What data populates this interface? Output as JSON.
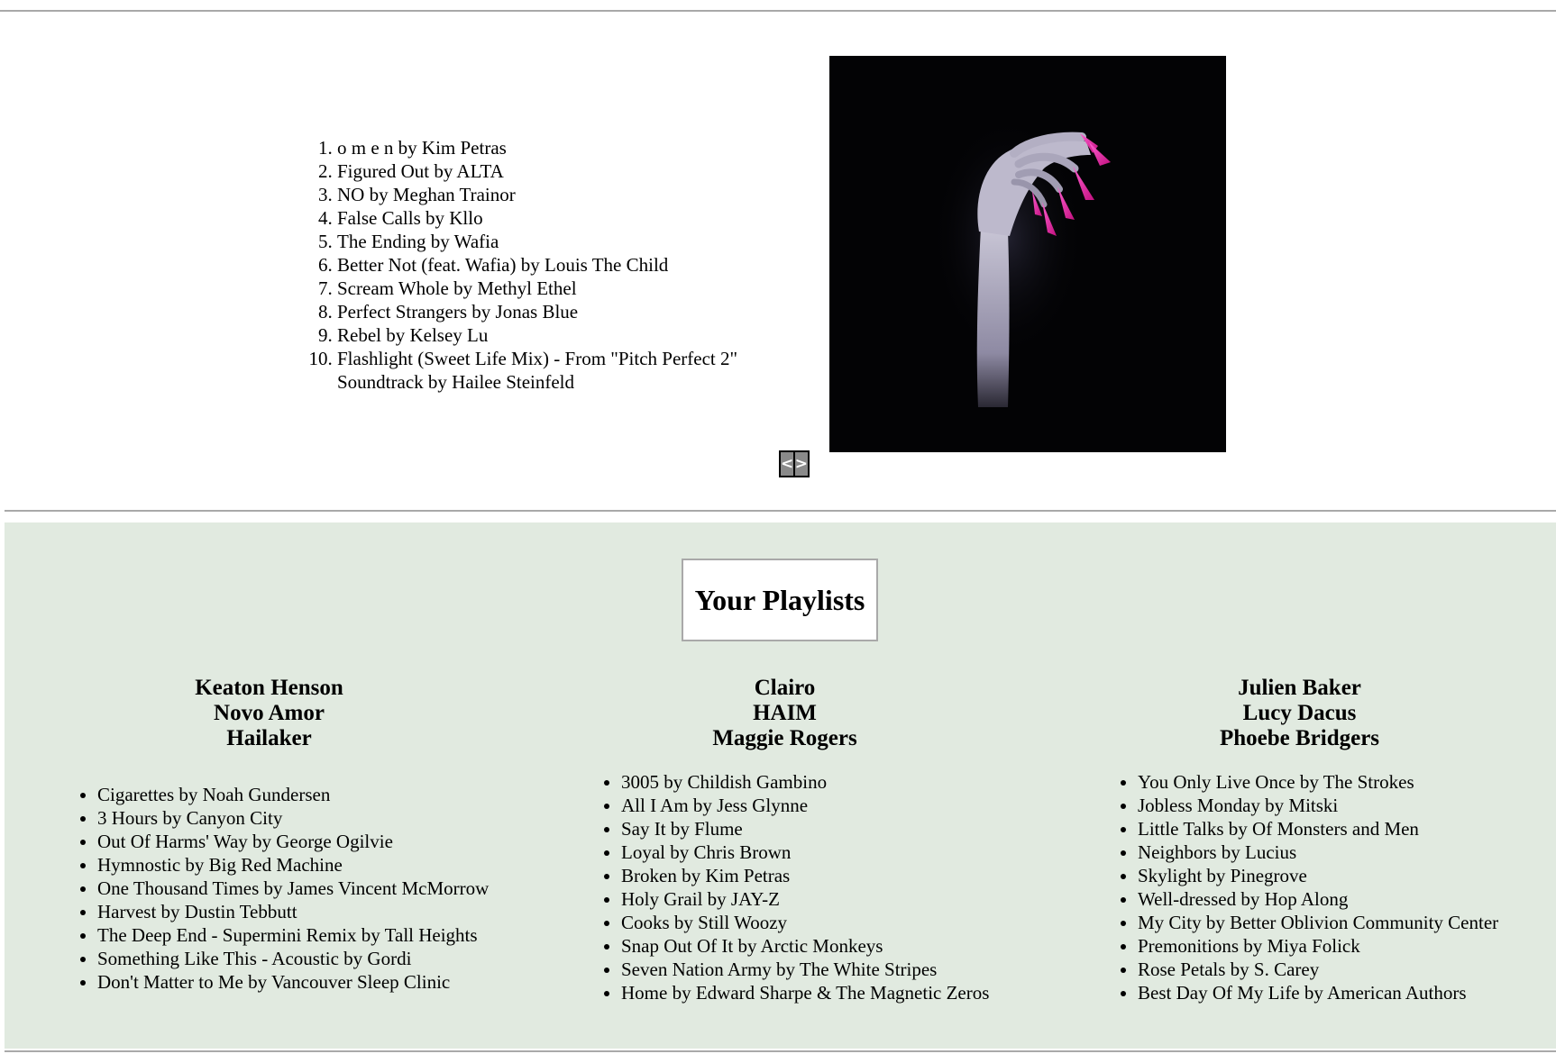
{
  "now_playing": {
    "tracks": [
      "o m e n by Kim Petras",
      "Figured Out by ALTA",
      "NO by Meghan Trainor",
      "False Calls by Kllo",
      "The Ending by Wafia",
      "Better Not (feat. Wafia) by Louis The Child",
      "Scream Whole by Methyl Ethel",
      "Perfect Strangers by Jonas Blue",
      "Rebel by Kelsey Lu",
      "Flashlight (Sweet Life Mix) - From \"Pitch Perfect 2\" Soundtrack by Hailee Steinfeld"
    ],
    "prev_label": "<",
    "next_label": ">"
  },
  "playlists": {
    "title": "Your Playlists",
    "items": [
      {
        "artists": [
          "Keaton Henson",
          "Novo Amor",
          "Hailaker"
        ],
        "songs": [
          "Cigarettes by Noah Gundersen",
          "3 Hours by Canyon City",
          "Out Of Harms' Way by George Ogilvie",
          "Hymnostic by Big Red Machine",
          "One Thousand Times by James Vincent McMorrow",
          "Harvest by Dustin Tebbutt",
          "The Deep End - Supermini Remix by Tall Heights",
          "Something Like This - Acoustic by Gordi",
          "Don't Matter to Me by Vancouver Sleep Clinic"
        ]
      },
      {
        "artists": [
          "Clairo",
          "HAIM",
          "Maggie Rogers"
        ],
        "songs": [
          "3005 by Childish Gambino",
          "All I Am by Jess Glynne",
          "Say It by Flume",
          "Loyal by Chris Brown",
          "Broken by Kim Petras",
          "Holy Grail by JAY-Z",
          "Cooks by Still Woozy",
          "Snap Out Of It by Arctic Monkeys",
          "Seven Nation Army by The White Stripes",
          "Home by Edward Sharpe & The Magnetic Zeros"
        ]
      },
      {
        "artists": [
          "Julien Baker",
          "Lucy Dacus",
          "Phoebe Bridgers"
        ],
        "songs": [
          "You Only Live Once by The Strokes",
          "Jobless Monday by Mitski",
          "Little Talks by Of Monsters and Men",
          "Neighbors by Lucius",
          "Skylight by Pinegrove",
          "Well-dressed by Hop Along",
          "My City by Better Oblivion Community Center",
          "Premonitions by Miya Folick",
          "Rose Petals by S. Carey",
          "Best Day Of My Life by American Authors"
        ]
      }
    ]
  }
}
